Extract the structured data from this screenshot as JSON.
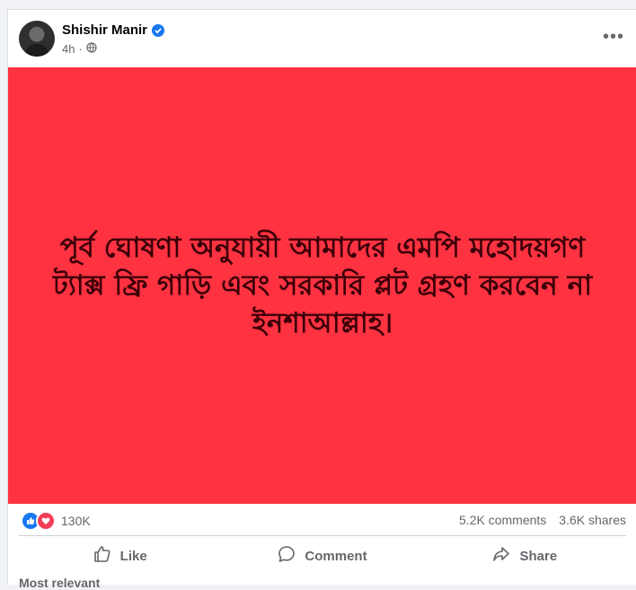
{
  "post": {
    "author": "Shishir Manir",
    "time": "4h",
    "image_text": "পূর্ব ঘোষণা অনুযায়ী আমাদের এমপি মহোদয়গণ ট্যাক্স ফ্রি গাড়ি এবং সরকারি প্লট গ্রহণ করবেন না ইনশাআল্লাহ।",
    "background_color": "#ff3241"
  },
  "stats": {
    "reactions_count": "130K",
    "comments": "5.2K comments",
    "shares": "3.6K shares"
  },
  "actions": {
    "like": "Like",
    "comment": "Comment",
    "share": "Share"
  },
  "footer": {
    "text": "Most relevant"
  }
}
